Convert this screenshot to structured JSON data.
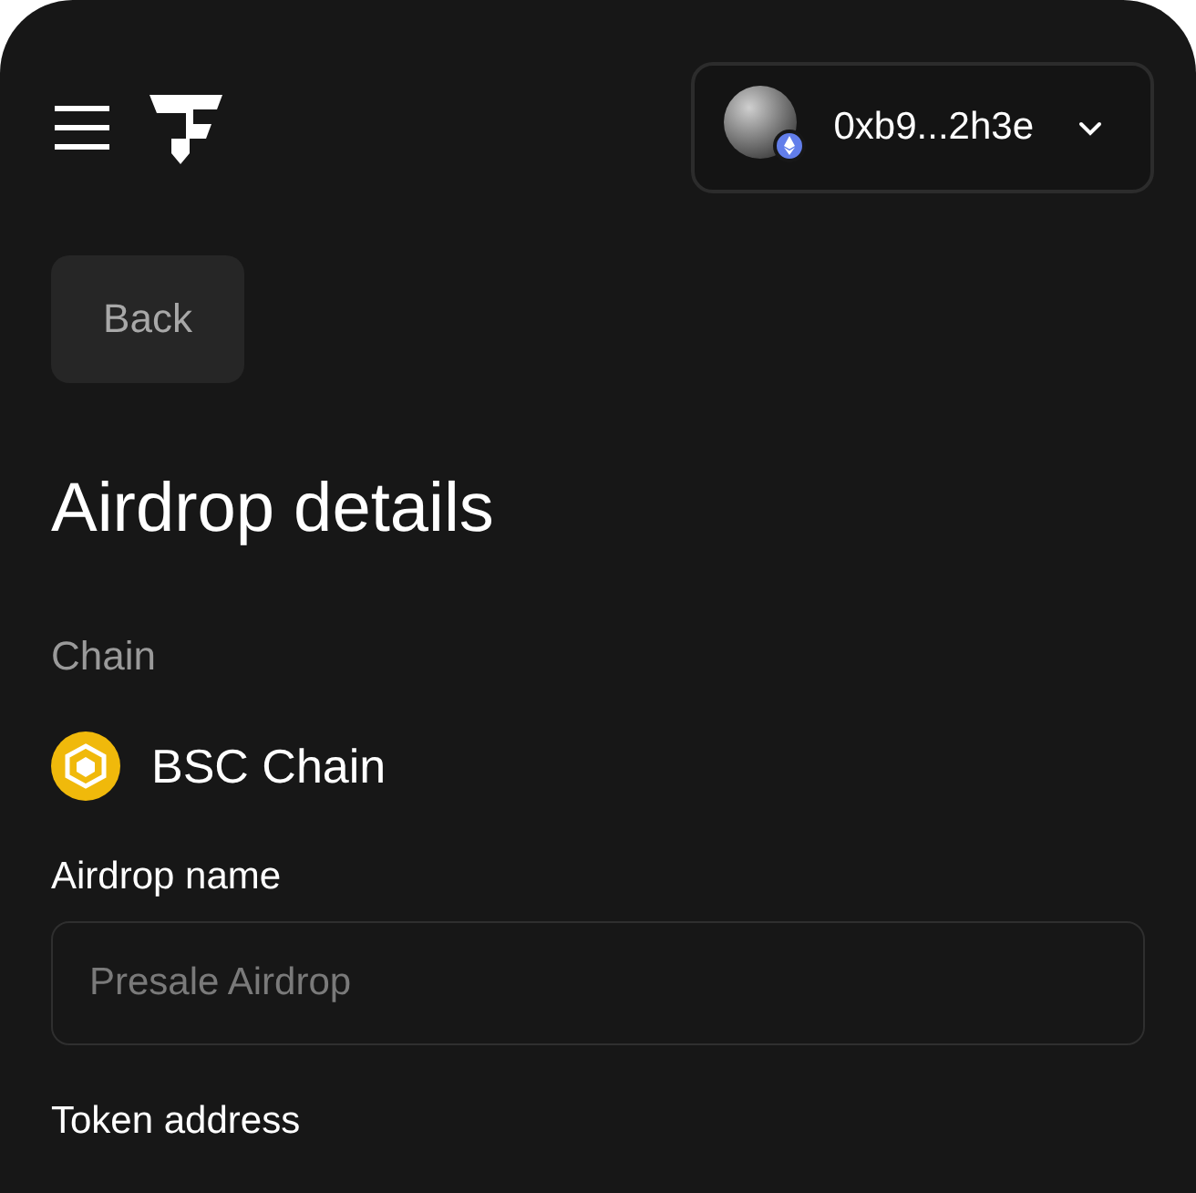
{
  "header": {
    "wallet": {
      "address": "0xb9...2h3e"
    }
  },
  "back_button": "Back",
  "title": "Airdrop details",
  "chain": {
    "label": "Chain",
    "name": "BSC Chain"
  },
  "fields": [
    {
      "label": "Airdrop name",
      "placeholder": "Presale Airdrop"
    },
    {
      "label": "Token address"
    }
  ]
}
